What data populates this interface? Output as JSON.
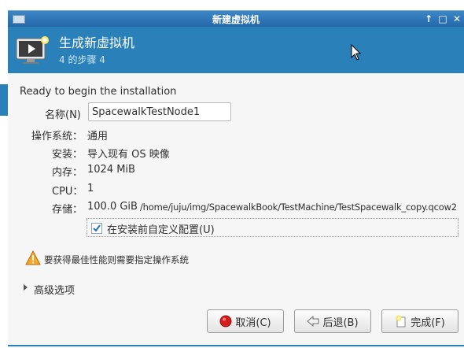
{
  "window": {
    "title": "新建虚拟机",
    "controls": {
      "up": "↑",
      "maximize": "□",
      "close": "✕"
    }
  },
  "header": {
    "title": "生成新虚拟机",
    "step": "4 的步骤 4"
  },
  "summary": {
    "heading": "Ready to begin the installation",
    "name_label": "名称(N)",
    "name_value": "SpacewalkTestNode1",
    "os_label": "操作系统：",
    "os_value": "通用",
    "install_label": "安装：",
    "install_value": "导入现有 OS 映像",
    "memory_label": "内存：",
    "memory_value": "1024 MiB",
    "cpu_label": "CPU：",
    "cpu_value": "1",
    "storage_label": "存储：",
    "storage_size": "100.0 GiB",
    "storage_path": "/home/juju/img/SpacewalkBook/TestMachine/TestSpacewalk_copy.qcow2"
  },
  "customize": {
    "label": "在安装前自定义配置(U)",
    "checked": true
  },
  "warning": {
    "text": "要获得最佳性能则需要指定操作系统",
    "icon": "warning-icon"
  },
  "advanced": {
    "label": "高级选项",
    "expanded": false
  },
  "buttons": {
    "cancel": "取消(C)",
    "back": "后退(B)",
    "finish": "完成(F)"
  },
  "colors": {
    "header_bg": "#2a80b9",
    "titlebar_bg": "#2d74b8",
    "content_bg": "#f6f6f6"
  }
}
